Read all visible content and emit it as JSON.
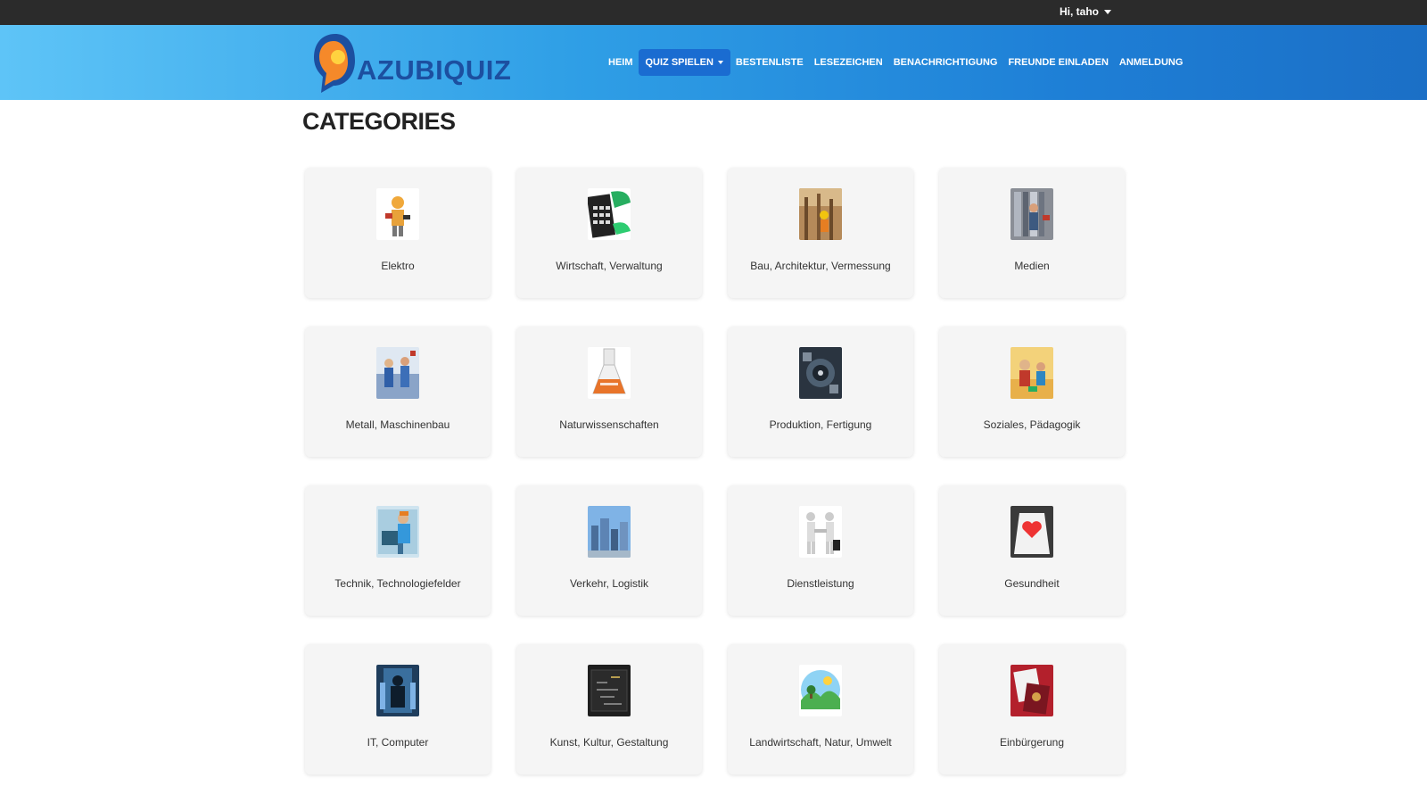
{
  "user": {
    "label": "Hi, taho"
  },
  "logo": {
    "text": "AZUBIQUIZ"
  },
  "nav": {
    "items": [
      {
        "label": "HEIM"
      },
      {
        "label": "QUIZ SPIELEN"
      },
      {
        "label": "BESTENLISTE"
      },
      {
        "label": "LESEZEICHEN"
      },
      {
        "label": "BENACHRICHTIGUNG"
      },
      {
        "label": "FREUNDE EINLADEN"
      },
      {
        "label": "ANMELDUNG"
      }
    ]
  },
  "page": {
    "title": "CATEGORIES"
  },
  "categories": [
    {
      "label": "Elektro",
      "icon": "electrician-icon"
    },
    {
      "label": "Wirtschaft, Verwaltung",
      "icon": "calculator-icon"
    },
    {
      "label": "Bau, Architektur, Vermessung",
      "icon": "construction-icon"
    },
    {
      "label": "Medien",
      "icon": "media-icon"
    },
    {
      "label": "Metall, Maschinenbau",
      "icon": "metalwork-icon"
    },
    {
      "label": "Naturwissenschaften",
      "icon": "flask-icon"
    },
    {
      "label": "Produktion, Fertigung",
      "icon": "production-icon"
    },
    {
      "label": "Soziales, Pädagogik",
      "icon": "social-icon"
    },
    {
      "label": "Technik, Technologiefelder",
      "icon": "technician-icon"
    },
    {
      "label": "Verkehr, Logistik",
      "icon": "city-icon"
    },
    {
      "label": "Dienstleistung",
      "icon": "handshake-icon"
    },
    {
      "label": "Gesundheit",
      "icon": "heart-icon"
    },
    {
      "label": "IT, Computer",
      "icon": "computer-icon"
    },
    {
      "label": "Kunst, Kultur, Gestaltung",
      "icon": "chalkboard-icon"
    },
    {
      "label": "Landwirtschaft, Natur, Umwelt",
      "icon": "nature-icon"
    },
    {
      "label": "Einbürgerung",
      "icon": "passport-icon"
    }
  ],
  "colors": {
    "topbar": "#2b2b2b",
    "nav_start": "#5ec4f7",
    "nav_end": "#1b6fc6",
    "nav_active": "#1a6cd1",
    "card_bg": "#f5f5f5"
  }
}
